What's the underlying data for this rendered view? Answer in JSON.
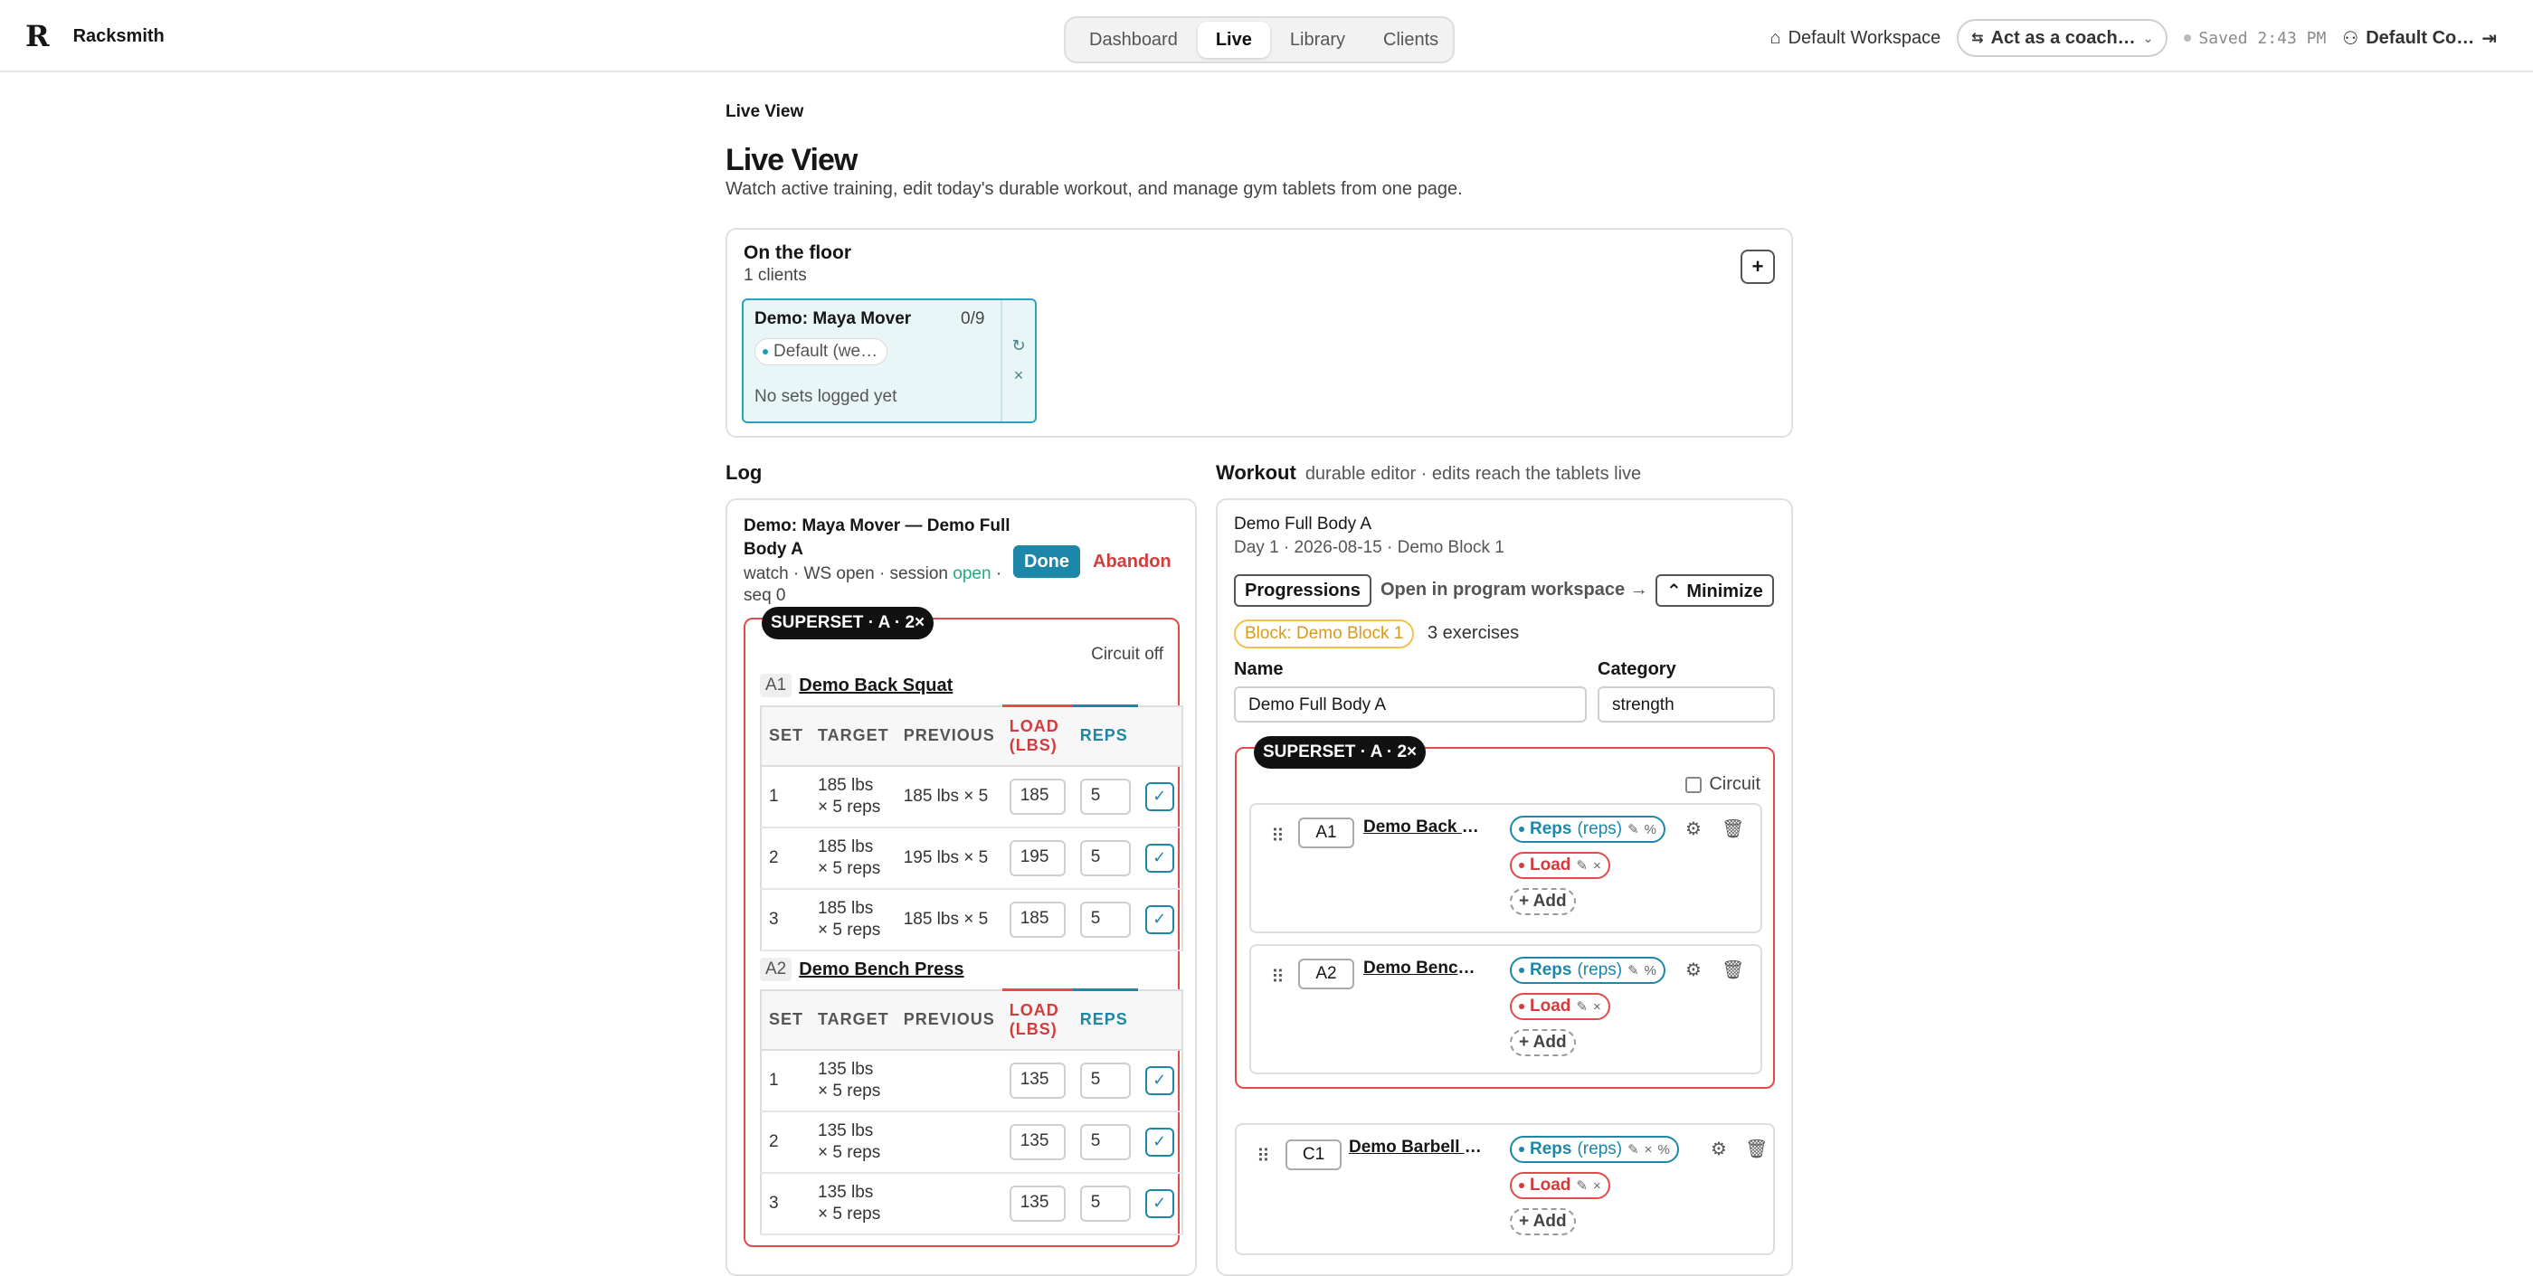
{
  "app": {
    "brand_mark": "R",
    "brand_name": "Racksmith"
  },
  "nav": {
    "tabs": [
      "Dashboard",
      "Live",
      "Library",
      "Clients"
    ],
    "active": "Live"
  },
  "topbar": {
    "workspace": "Default Workspace",
    "coach": "Act as a coach…",
    "saved": "Saved 2:43 PM",
    "user": "Default Co…"
  },
  "page": {
    "breadcrumb": "Live View",
    "title": "Live View",
    "subtitle": "Watch active training, edit today's durable workout, and manage gym tablets from one page."
  },
  "floor": {
    "title": "On the floor",
    "count": "1 clients",
    "client": {
      "name": "Demo: Maya Mover",
      "progress": "0/9",
      "workspace": "Default (we…",
      "status": "No sets logged yet"
    }
  },
  "log": {
    "label": "Log",
    "title": "Demo: Maya Mover — Demo Full Body A",
    "meta_pre": "watch · WS open · session",
    "meta_open": "open",
    "meta_post": "· seq 0",
    "done": "Done",
    "abandon": "Abandon",
    "superset": "SUPERSET · A · 2×",
    "circuit": "Circuit off",
    "columns": {
      "set": "SET",
      "target": "TARGET",
      "previous": "PREVIOUS",
      "load": "LOAD (LBS)",
      "reps": "REPS"
    },
    "exercises": [
      {
        "num": "A1",
        "name": "Demo Back Squat",
        "sets": [
          {
            "set": "1",
            "target_a": "185 lbs",
            "target_b": "× 5 reps",
            "previous": "185 lbs × 5",
            "load": "185",
            "reps": "5"
          },
          {
            "set": "2",
            "target_a": "185 lbs",
            "target_b": "× 5 reps",
            "previous": "195 lbs × 5",
            "load": "195",
            "reps": "5"
          },
          {
            "set": "3",
            "target_a": "185 lbs",
            "target_b": "× 5 reps",
            "previous": "185 lbs × 5",
            "load": "185",
            "reps": "5"
          }
        ]
      },
      {
        "num": "A2",
        "name": "Demo Bench Press",
        "sets": [
          {
            "set": "1",
            "target_a": "135 lbs",
            "target_b": "× 5 reps",
            "previous": "",
            "load": "135",
            "reps": "5"
          },
          {
            "set": "2",
            "target_a": "135 lbs",
            "target_b": "× 5 reps",
            "previous": "",
            "load": "135",
            "reps": "5"
          },
          {
            "set": "3",
            "target_a": "135 lbs",
            "target_b": "× 5 reps",
            "previous": "",
            "load": "135",
            "reps": "5"
          }
        ]
      }
    ]
  },
  "workout": {
    "label": "Workout",
    "note": "durable editor · edits reach the tablets live",
    "title": "Demo Full Body A",
    "day": "Day 1 · 2026-08-15 · Demo Block 1",
    "progressions": "Progressions",
    "open_link": "Open in program workspace →",
    "minimize": "⌃ Minimize",
    "block": "Block: Demo Block 1",
    "exercise_count": "3 exercises",
    "name_label": "Name",
    "name_value": "Demo Full Body A",
    "category_label": "Category",
    "category_value": "strength",
    "superset": "SUPERSET · A · 2×",
    "circuit": "Circuit",
    "chips": {
      "reps": "Reps",
      "reps_unit": "(reps)",
      "load": "Load",
      "add": "+ Add"
    },
    "cards": [
      {
        "slot": "A1",
        "name": "Demo Back S…"
      },
      {
        "slot": "A2",
        "name": "Demo Bench …"
      },
      {
        "slot": "C1",
        "name": "Demo Barbell R…"
      }
    ]
  },
  "icons": {
    "colors": {
      "accent": "#1c87a8",
      "danger": "#e24b4b",
      "success": "#1bb07a",
      "block": "#f3c04d"
    }
  }
}
